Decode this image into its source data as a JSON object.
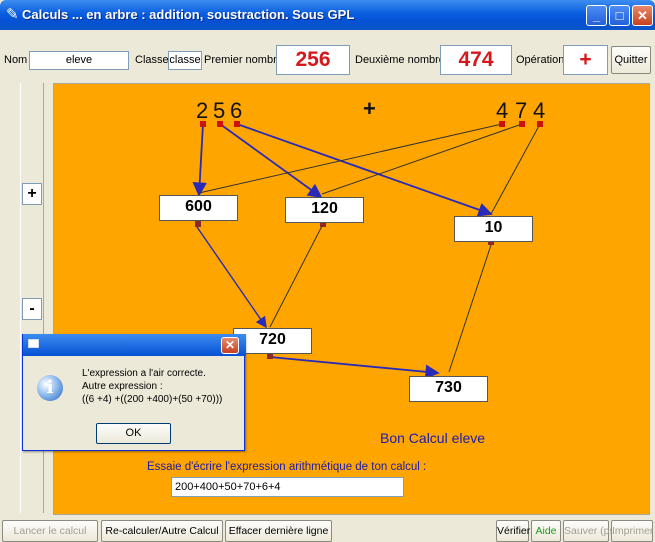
{
  "window": {
    "title": "Calculs ... en arbre : addition, soustraction. Sous GPL",
    "min": "_",
    "max": "□",
    "close": "✕"
  },
  "toolbar": {
    "nom_label": "Nom",
    "nom_value": "eleve",
    "classe_label": "Classe",
    "classe_value": "classe",
    "premier_label": "Premier nombre",
    "premier_value": "256",
    "deuxieme_label": "Deuxième nombre",
    "deuxieme_value": "474",
    "operation_label": "Opération",
    "operation_value": "+",
    "quitter": "Quitter"
  },
  "side": {
    "plus": "+",
    "minus": "-"
  },
  "canvas": {
    "first_digits": [
      "2",
      "5",
      "6"
    ],
    "operator": "+",
    "second_digits": [
      "4",
      "7",
      "4"
    ],
    "results": [
      "600",
      "120",
      "10",
      "720",
      "730"
    ],
    "message": "Bon Calcul eleve",
    "prompt": "Essaie d'écrire l'expression arithmétique de ton calcul :",
    "expression": "200+400+50+70+6+4"
  },
  "dialog": {
    "line1": "L'expression a l'air correcte.",
    "line2": "Autre expression :",
    "line3": "((6 +4) +((200 +400)+(50 +70)))",
    "ok": "OK",
    "close": "✕",
    "icon": "i"
  },
  "bottom": {
    "lancer": "Lancer le calcul",
    "recalculer": "Re-calculer/Autre Calcul",
    "effacer": "Effacer dernière ligne",
    "verifier": "Vérifier",
    "aide": "Aide",
    "sauver": "Sauver (ps)",
    "imprimer": "Imprimer"
  },
  "colors": {
    "canvas": "#ffa500",
    "accent_red": "#d6171b",
    "message_blue": "#1a1ab0",
    "arrow_blue": "#2a2ab8",
    "aide_green": "#1a9a1a"
  }
}
